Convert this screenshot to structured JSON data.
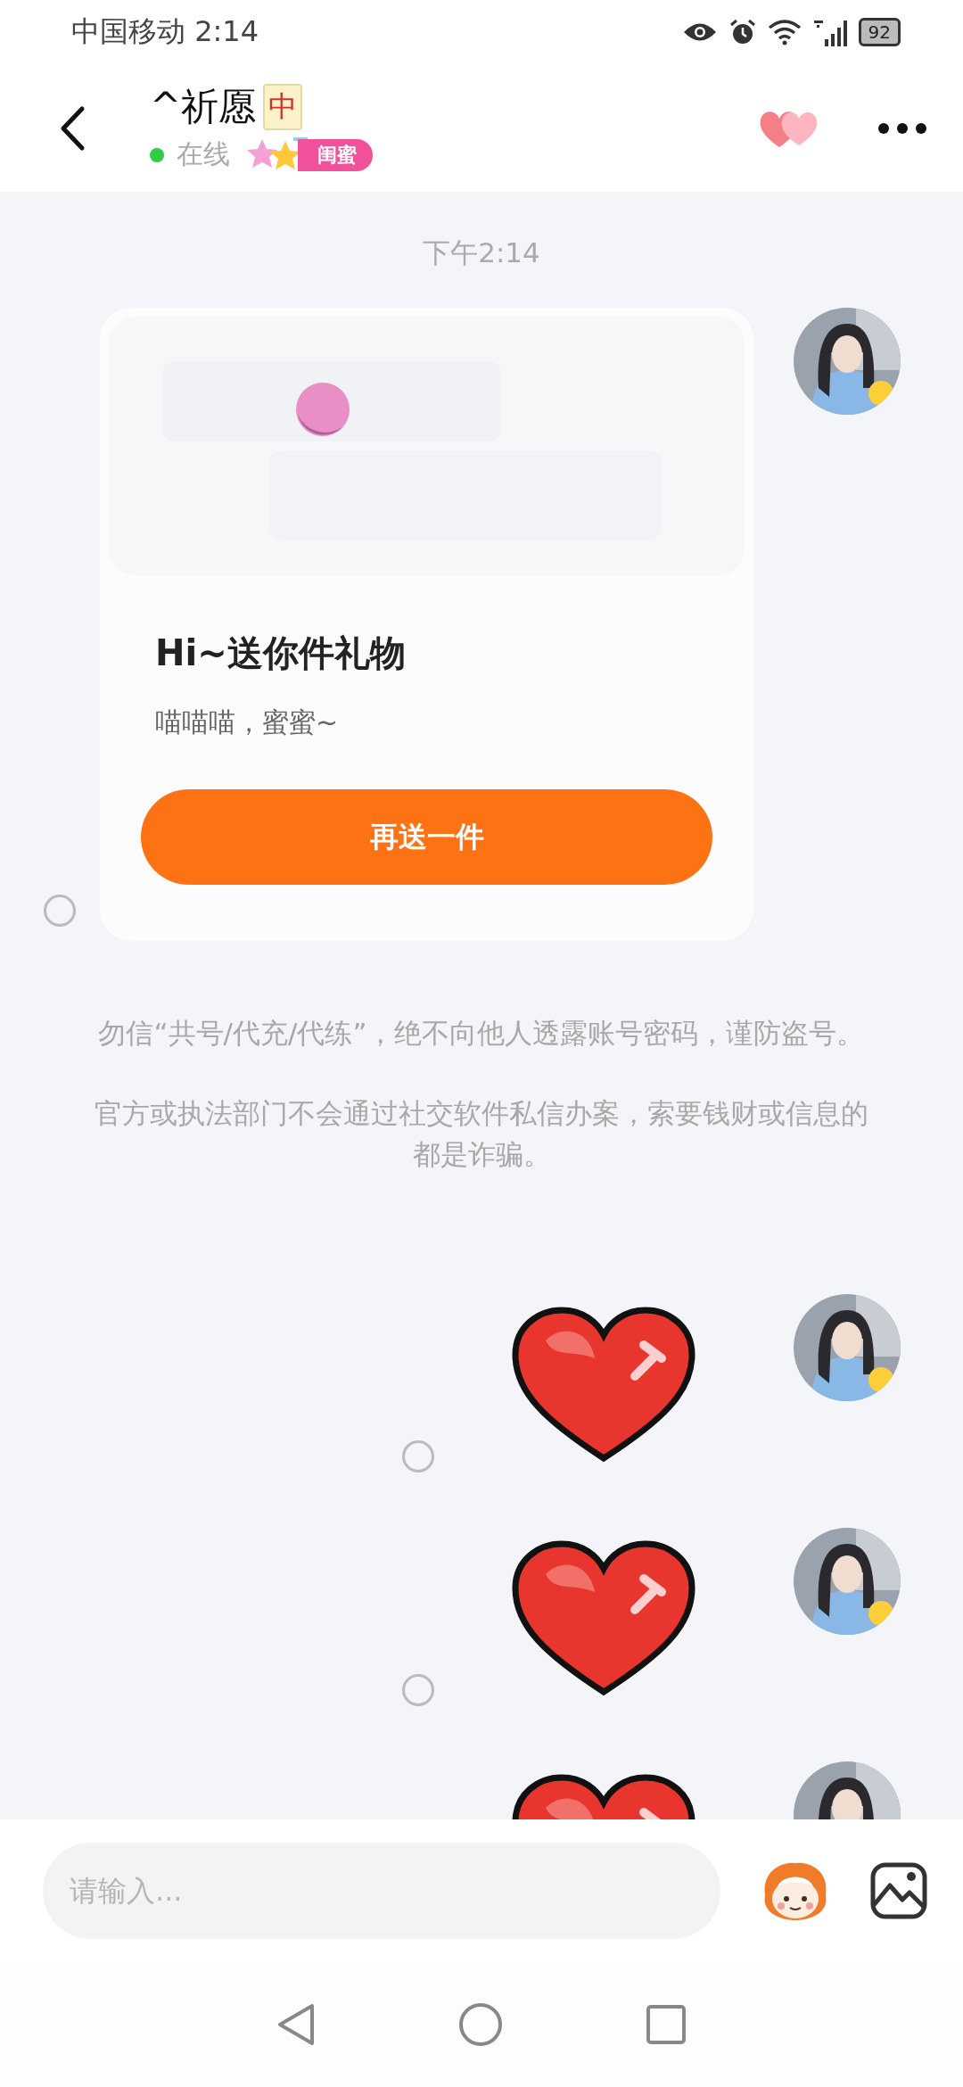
{
  "status_bar": {
    "carrier": "中国移动",
    "time": "2:14",
    "battery": "92"
  },
  "header": {
    "title": "^祈愿",
    "title_badge": "中",
    "status": "在线",
    "online": true,
    "relation_tag": "闺蜜"
  },
  "chat": {
    "timestamp": "下午2:14",
    "messages": [
      {
        "kind": "gift_card",
        "title": "Hi~送你件礼物",
        "text": "喵喵喵，蜜蜜~",
        "button": "再送一件",
        "selected": false
      },
      {
        "kind": "notice",
        "text": "勿信“共号/代充/代练”，绝不向他人透露账号密码，谨防盗号。"
      },
      {
        "kind": "notice",
        "text": "官方或执法部门不会通过社交软件私信办案，索要钱财或信息的都是诈骗。"
      },
      {
        "kind": "sticker",
        "selected": false
      },
      {
        "kind": "sticker",
        "selected": false
      },
      {
        "kind": "sticker"
      }
    ]
  },
  "composer": {
    "placeholder": "请输入..."
  }
}
